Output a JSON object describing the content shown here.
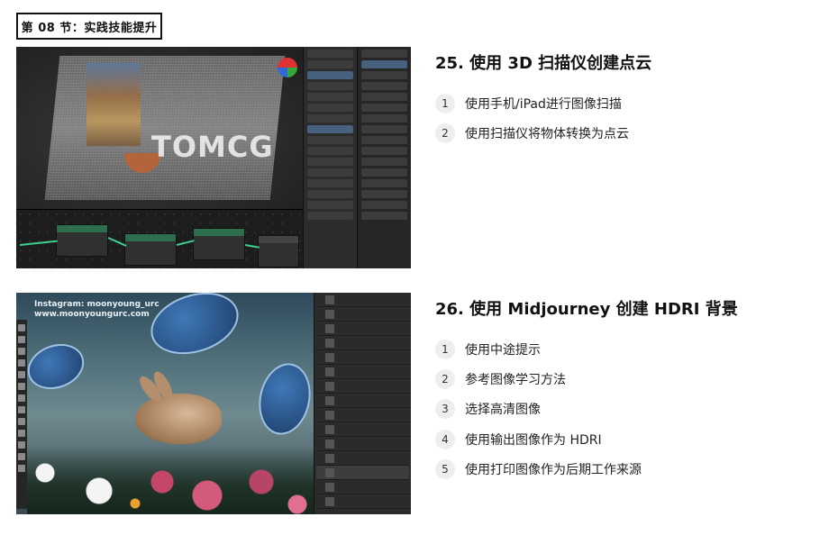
{
  "section": {
    "tag": "第 08 节：实践技能提升"
  },
  "items": [
    {
      "title": "25. 使用 3D 扫描仪创建点云",
      "steps": [
        {
          "num": "1",
          "text": "使用手机/iPad进行图像扫描"
        },
        {
          "num": "2",
          "text": "使用扫描仪将物体转换为点云"
        }
      ],
      "screenshot": {
        "kind": "blender-point-cloud",
        "watermark": "TOMCG"
      }
    },
    {
      "title": "26. 使用 Midjourney 创建 HDRI 背景",
      "steps": [
        {
          "num": "1",
          "text": "使用中途提示"
        },
        {
          "num": "2",
          "text": "参考图像学习方法"
        },
        {
          "num": "3",
          "text": "选择高清图像"
        },
        {
          "num": "4",
          "text": "使用输出图像作为 HDRI"
        },
        {
          "num": "5",
          "text": "使用打印图像作为后期工作来源"
        }
      ],
      "screenshot": {
        "kind": "photoshop-underwater-rabbit",
        "caption_line1": "Instagram: moonyoung_urc",
        "caption_line2": "www.moonyoungurc.com"
      }
    }
  ],
  "colors": {
    "accent": "#111111",
    "badge_bg": "#eeeeee",
    "node_wire": "#3ecf8e"
  }
}
